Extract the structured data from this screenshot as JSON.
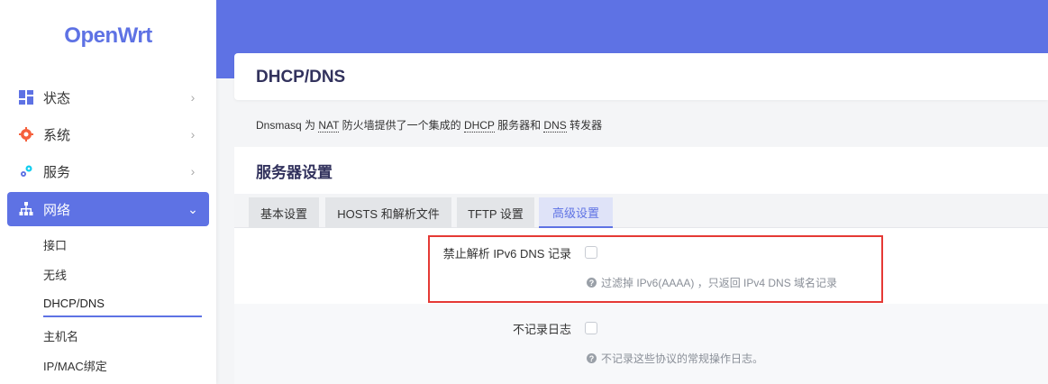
{
  "brand": "OpenWrt",
  "sidebar": {
    "items": [
      {
        "label": "状态",
        "icon": "dashboard-icon"
      },
      {
        "label": "系统",
        "icon": "gear-icon"
      },
      {
        "label": "服务",
        "icon": "services-icon"
      },
      {
        "label": "网络",
        "icon": "network-icon"
      }
    ],
    "sub_items": [
      "接口",
      "无线",
      "DHCP/DNS",
      "主机名",
      "IP/MAC绑定"
    ]
  },
  "page": {
    "title": "DHCP/DNS",
    "description_parts": [
      "Dnsmasq 为 ",
      "NAT",
      " 防火墙提供了一个集成的 ",
      "DHCP",
      " 服务器和 ",
      "DNS",
      " 转发器"
    ]
  },
  "section": {
    "title": "服务器设置",
    "tabs": [
      "基本设置",
      "HOSTS 和解析文件",
      "TFTP 设置",
      "高级设置"
    ],
    "active_tab": "高级设置"
  },
  "options": [
    {
      "label": "禁止解析 IPv6 DNS 记录",
      "checked": false,
      "hint": "过滤掉 IPv6(AAAA) ，只返回 IPv4 DNS 域名记录"
    },
    {
      "label": "不记录日志",
      "checked": false,
      "hint": "不记录这些协议的常规操作日志。"
    }
  ],
  "colors": {
    "accent": "#5e72e4",
    "highlight": "#e53935"
  }
}
